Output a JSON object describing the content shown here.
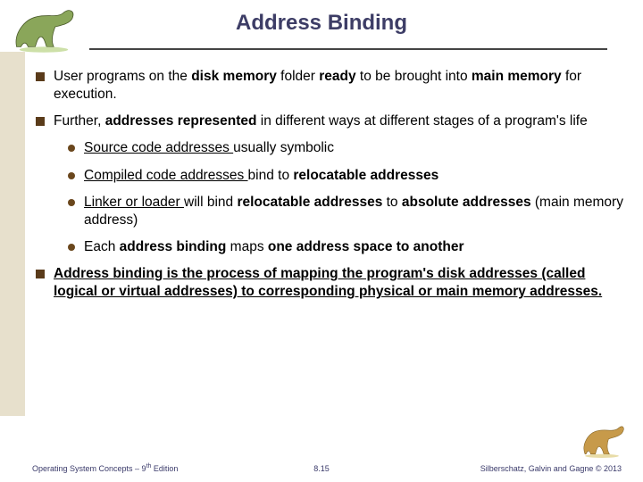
{
  "title": "Address Binding",
  "bullets": {
    "b1": {
      "pre": "User programs on the ",
      "s1": "disk memory",
      "mid1": " folder ",
      "s2": "ready",
      "mid2": " to be brought into ",
      "s3": "main memory",
      "post": " for execution."
    },
    "b2": {
      "pre": "Further, ",
      "s1": "addresses represented",
      "post": " in different ways at different stages of a program's life"
    },
    "b2a": {
      "u": "Source code addresses ",
      "post": "usually symbolic"
    },
    "b2b": {
      "u": "Compiled code addresses ",
      "mid": "bind to",
      "b": " relocatable addresses"
    },
    "b2c": {
      "u": "Linker or loader ",
      "mid1": "will bind ",
      "b1": "relocatable addresses",
      "mid2": " to ",
      "b2": "absolute addresses",
      "post": " (main memory address)"
    },
    "b2d": {
      "pre": "Each  ",
      "b1": "address binding",
      "mid": " maps ",
      "b2": "one address space to another"
    },
    "b3": {
      "u": "Address binding is the process of mapping the program's disk addresses (called logical or virtual addresses) to corresponding physical or main memory addresses."
    }
  },
  "footer": {
    "left_pre": "Operating System Concepts – 9",
    "left_sup": "th",
    "left_post": " Edition",
    "mid": "8.15",
    "right": "Silberschatz, Galvin and Gagne © 2013"
  }
}
